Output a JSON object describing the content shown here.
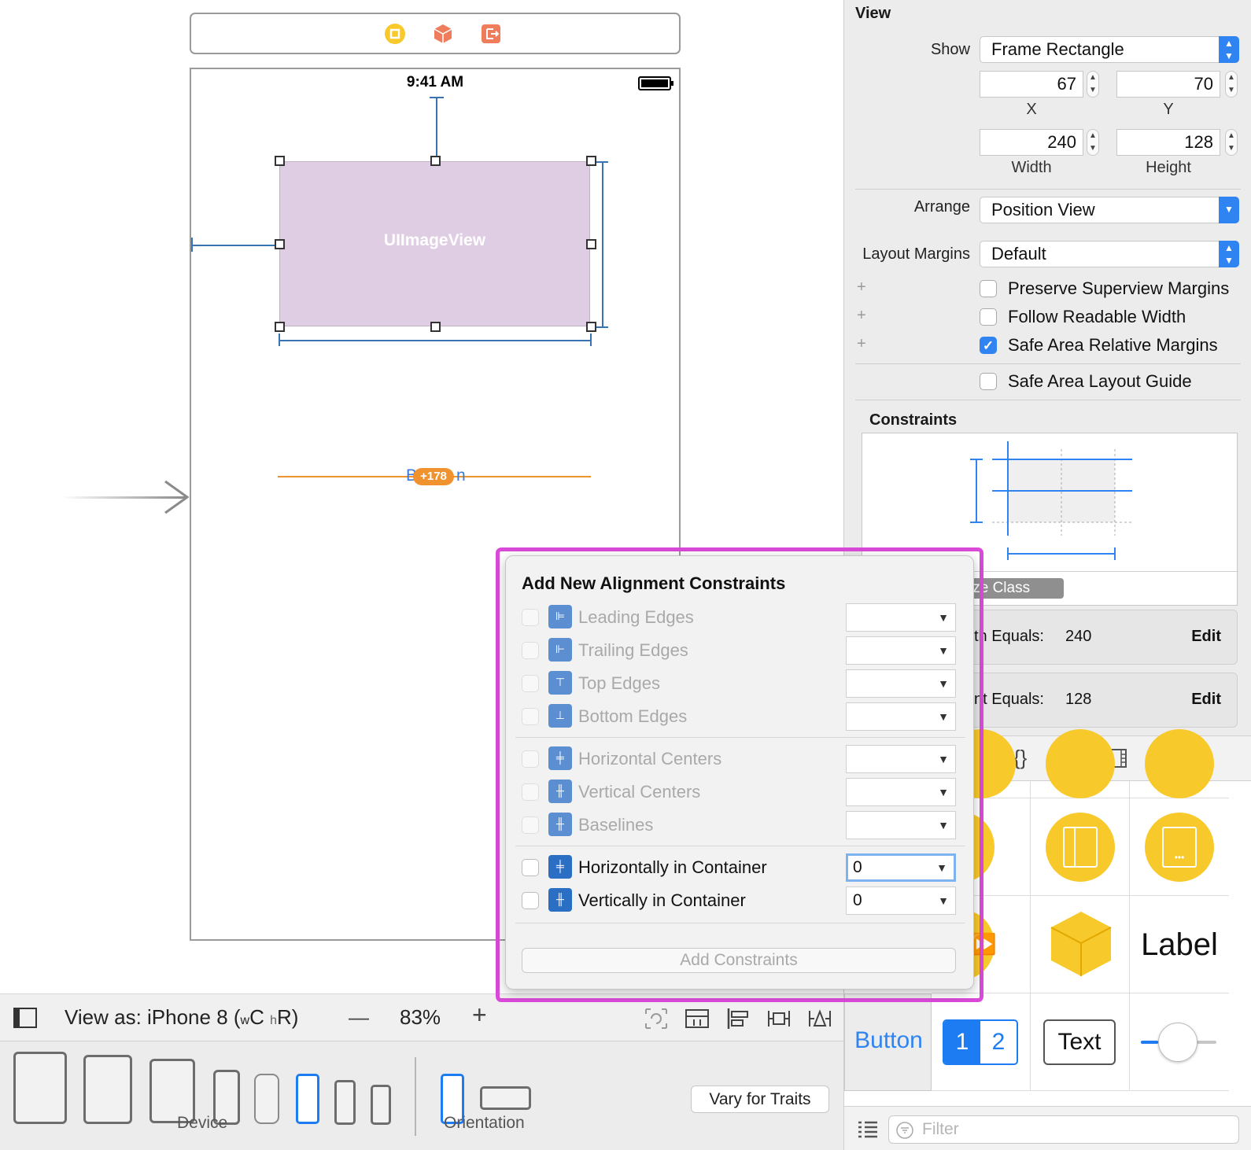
{
  "canvas": {
    "status_time": "9:41 AM",
    "image_view_label": "UIImageView",
    "button_fragment_left": "B",
    "button_fragment_right": "n",
    "offset_badge": "+178"
  },
  "bottom_bar": {
    "view_as_prefix": "View as: iPhone 8 (",
    "view_as_w": "w",
    "view_as_C": "C",
    "view_as_h": "h",
    "view_as_R": "R)",
    "zoom_minus": "—",
    "zoom_level": "83%",
    "zoom_plus": "+"
  },
  "device_bar": {
    "device_label": "Device",
    "orientation_label": "Orientation",
    "vary_button": "Vary for Traits"
  },
  "inspector": {
    "section_title": "View",
    "show_label": "Show",
    "show_value": "Frame Rectangle",
    "x_value": "67",
    "y_value": "70",
    "x_label": "X",
    "y_label": "Y",
    "width_value": "240",
    "height_value": "128",
    "width_label": "Width",
    "height_label": "Height",
    "arrange_label": "Arrange",
    "arrange_value": "Position View",
    "layout_margins_label": "Layout Margins",
    "layout_margins_value": "Default",
    "preserve_superview": "Preserve Superview Margins",
    "follow_readable": "Follow Readable Width",
    "safe_area_relative": "Safe Area Relative Margins",
    "safe_area_guide": "Safe Area Layout Guide",
    "plus": "+",
    "constraints_title": "Constraints",
    "size_class_button": "ize Class",
    "width_constraint_text": "th Equals:",
    "width_constraint_value": "240",
    "height_constraint_text": "nt Equals:",
    "height_constraint_value": "128",
    "edit_label": "Edit"
  },
  "library": {
    "tab_code": "{}",
    "label_item": "Label",
    "button_item": "Button",
    "segment_1": "1",
    "segment_2": "2",
    "text_item": "Text",
    "filter_placeholder": "Filter"
  },
  "popover": {
    "title": "Add New Alignment Constraints",
    "rows": [
      {
        "label": "Leading Edges",
        "value": ""
      },
      {
        "label": "Trailing Edges",
        "value": ""
      },
      {
        "label": "Top Edges",
        "value": ""
      },
      {
        "label": "Bottom Edges",
        "value": ""
      },
      {
        "label": "Horizontal Centers",
        "value": ""
      },
      {
        "label": "Vertical Centers",
        "value": ""
      },
      {
        "label": "Baselines",
        "value": ""
      },
      {
        "label": "Horizontally in Container",
        "value": "0"
      },
      {
        "label": "Vertically in Container",
        "value": "0"
      }
    ],
    "add_button": "Add Constraints",
    "dropdown_glyph": "▼"
  },
  "colors": {
    "accent_blue": "#2f84f1",
    "highlight_magenta": "#d94ad8",
    "constraint_orange": "#f0932e",
    "image_view_fill": "#dfcde4",
    "library_yellow": "#f8c92b"
  }
}
